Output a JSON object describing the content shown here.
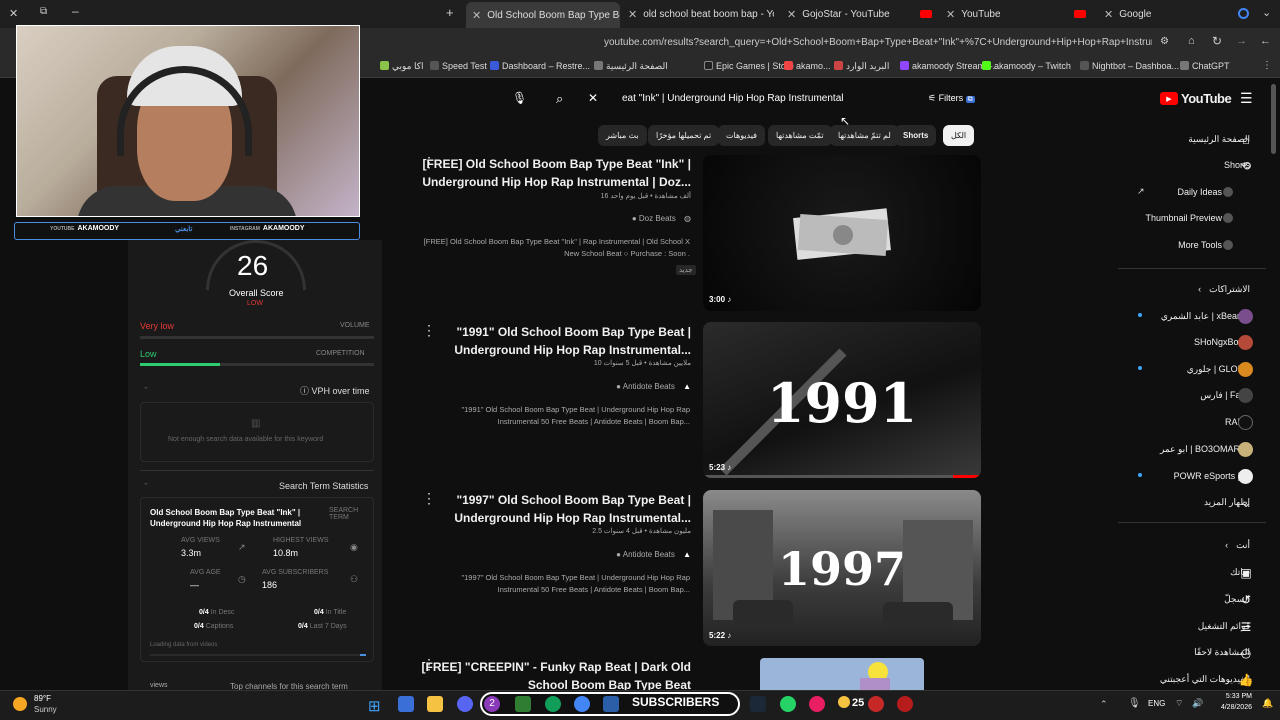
{
  "browser": {
    "tabs": [
      {
        "label": "Old School Boom Bap Type Bea",
        "active": true
      },
      {
        "label": "old school beat boom bap - Yo"
      },
      {
        "label": "GojoStar - YouTube"
      },
      {
        "label": "YouTube"
      },
      {
        "label": "Google"
      }
    ],
    "url": "youtube.com/results?search_query=+Old+School+Boom+Bap+Type+Beat+\"Ink\"+%7C+Underground+Hip+Hop+Rap+Instrumental",
    "bookmarks": [
      "اكا موبي",
      "Speed Test",
      "Dashboard – Restre...",
      "الصفحة الرئيسية",
      "Epic Games | Store",
      "akamo...",
      "البريد الوارد",
      "akamoody Stream –...",
      "akamoody – Twitch",
      "Nightbot – Dashboa...",
      "ChatGPT"
    ]
  },
  "overlay": {
    "youtube_tag": "AKAMOODY",
    "youtube_label": "YOUTUBE",
    "follow_text": "تابعني",
    "instagram_tag": "AKAMOODY",
    "instagram_label": "INSTAGRAM"
  },
  "seo_panel": {
    "score": "26",
    "score_label": "Overall Score",
    "score_level": "LOW",
    "volume_value": "Very low",
    "volume_label": "VOLUME",
    "competition_value": "Low",
    "competition_label": "COMPETITION",
    "competition_fill": 0.34,
    "vph_label": "VPH over time",
    "no_data": "Not enough search data available for this keyword",
    "stats_heading": "Search Term Statistics",
    "search_term": "Old School Boom Bap Type Beat \"Ink\" | Underground Hip Hop Rap Instrumental",
    "search_term_label": "SEARCH TERM",
    "avg_views_label": "AVG VIEWS",
    "avg_views": "3.3m",
    "highest_views_label": "HIGHEST VIEWS",
    "highest_views": "10.8m",
    "avg_age_label": "AVG AGE",
    "avg_age": "—",
    "avg_subs_label": "AVG SUBSCRIBERS",
    "avg_subs": "186",
    "in_desc_val": "0/4",
    "in_desc": "In Desc",
    "in_title_val": "0/4",
    "in_title": "In Title",
    "captions_val": "0/4",
    "captions": "Captions",
    "last7_val": "0/4",
    "last7": "Last 7 Days",
    "loading": "Loading data from videos",
    "views_label": "views",
    "top_channels": "Top channels for this search term"
  },
  "youtube": {
    "search_text": "eat \"Ink\" | Underground Hip Hop Rap Instrumental",
    "filters": "Filters",
    "logo": "YouTube",
    "chips": [
      "الكل",
      "Shorts",
      "لم تتمّ مشاهدتها",
      "تمّت مشاهدتها",
      "فيديوهات",
      "تم تحميلها مؤخرًا",
      "بث مباشر"
    ],
    "videos": [
      {
        "title1": "[FREE] Old School Boom Bap Type Beat \"Ink\" |",
        "title2": "Underground Hip Hop Rap Instrumental | Doz...",
        "meta": "16 ألف مشاهدة • قبل يوم واحد",
        "channel": "Doz Beats",
        "desc1": "[FREE] Old School Boom Bap Type Beat \"Ink\" | Rap Instrumental | Old School X",
        "desc2": "New School Beat ○ Purchase : Soon .",
        "badge": "جديد",
        "duration": "3:00",
        "art": "cash"
      },
      {
        "title1": "\"1991\" Old School Boom Bap Type Beat |",
        "title2": "Underground Hip Hop Rap Instrumental...",
        "meta": "10 ملايين مشاهدة • قبل 5 سنوات",
        "channel": "Antidote Beats",
        "desc1": "\"1991\" Old School Boom Bap Type Beat | Underground Hip Hop Rap",
        "desc2": "Instrumental 50 Free Beats | Antidote Beats | Boom Bap...",
        "badge": "",
        "duration": "5:23",
        "art": "1991"
      },
      {
        "title1": "\"1997\" Old School Boom Bap Type Beat |",
        "title2": "Underground Hip Hop Rap Instrumental...",
        "meta": "2.5 مليون مشاهدة • قبل 4 سنوات",
        "channel": "Antidote Beats",
        "desc1": "\"1997\" Old School Boom Bap Type Beat | Underground Hip Hop Rap",
        "desc2": "Instrumental 50 Free Beats | Antidote Beats | Boom Bap...",
        "badge": "",
        "duration": "5:22",
        "art": "1997"
      },
      {
        "title1": "[FREE] \"CREEPIN\" - Funky Rap Beat | Dark Old",
        "title2": "School Boom Bap Type Beat",
        "art": "cartoon"
      }
    ]
  },
  "sidebar": {
    "main": [
      "الصفحة الرئيسية",
      "Shorts"
    ],
    "tools": [
      "Daily Ideas",
      "Thumbnail Preview",
      "More Tools"
    ],
    "subs_heading": "الاشتراكات",
    "subs": [
      "عابد الشمري | xBear ...",
      "SHoNgxBoNg",
      "جلوري | GLORY",
      "فارس | Faris",
      "RAED",
      "ابو عمر | BO3OMAR22",
      "POWR eSports | ..."
    ],
    "show_more": "إظهار المزيد",
    "you_heading": "أنت",
    "you": [
      "قناتك",
      "السجلّ",
      "قوائم التشغيل",
      "المشاهدة لاحقًا",
      "الفيديوهات التي أعجبتني"
    ]
  },
  "taskbar": {
    "temp": "89°F",
    "weather": "Sunny",
    "badge_count": "2",
    "overlay_text": "SUBSCRIBERS",
    "counter": "25",
    "lang": "ENG",
    "time": "5:33 PM",
    "date": "4/28/2026"
  }
}
